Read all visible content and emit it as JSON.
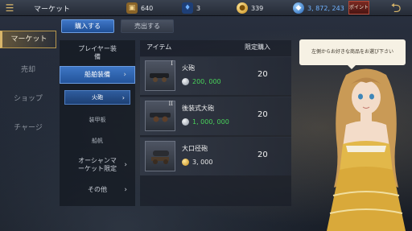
{
  "topbar": {
    "title": "マーケット",
    "menu_icon": "hamburger-icon",
    "resources": [
      {
        "name": "treasure-chest-icon",
        "value": "640",
        "color": "#b78b3f"
      },
      {
        "name": "blue-potion-icon",
        "value": "3",
        "color": "#3e7fd8"
      },
      {
        "name": "gold-coin-icon",
        "value": "339",
        "color": "#d8a93a"
      },
      {
        "name": "blue-gem-icon",
        "value": "3, 872, 243",
        "color": "#3e8fe0"
      }
    ],
    "point_label": "ポイント",
    "back_icon": "back-arrow-icon"
  },
  "leftnav": {
    "items": [
      {
        "label": "マーケット",
        "active": true
      },
      {
        "label": "売却",
        "active": false
      },
      {
        "label": "ショップ",
        "active": false
      },
      {
        "label": "チャージ",
        "active": false
      }
    ]
  },
  "tabs": {
    "buy": "購入する",
    "sell": "売出する"
  },
  "categories": {
    "player_equipment": "プレイヤー装\n備",
    "ship_equipment": "船舶装備",
    "sub": {
      "cannon": "火砲",
      "armor": "装甲板",
      "sail": "船帆"
    },
    "ocean_limited": "オーシャンマ\nーケット限定",
    "other": "その他"
  },
  "items": {
    "header_item": "アイテム",
    "header_limit": "限定購入",
    "rows": [
      {
        "name": "火砲",
        "tier": "I",
        "price": "200, 000",
        "currency": "silver",
        "limit": "20"
      },
      {
        "name": "後装式大砲",
        "tier": "II",
        "price": "1, 000, 000",
        "currency": "silver",
        "limit": "20"
      },
      {
        "name": "大口径砲",
        "tier": "",
        "price": "3, 000",
        "currency": "gold",
        "limit": "20"
      }
    ]
  },
  "npc": {
    "message": "左側からお好きな商品をお選び下さい"
  },
  "colors": {
    "accent_blue": "#2f64b4",
    "gold": "#d9b66a",
    "price_green": "#49d35a"
  }
}
